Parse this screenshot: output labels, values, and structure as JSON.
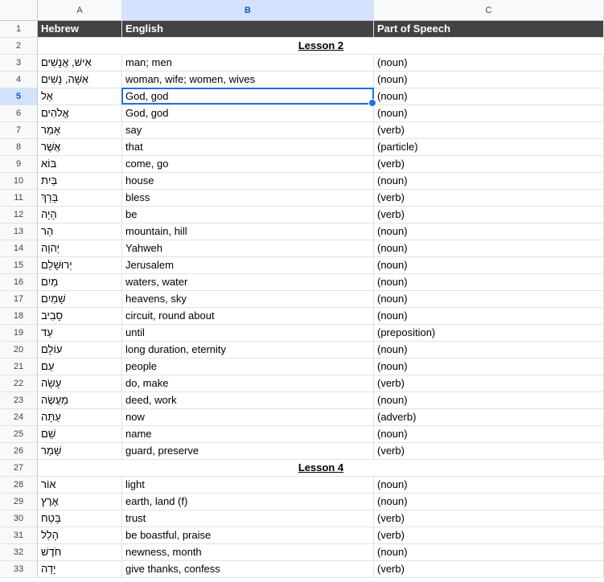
{
  "columns": [
    "A",
    "B",
    "C"
  ],
  "header_row": {
    "num": "1",
    "a": "Hebrew",
    "b": "English",
    "c": "Part of Speech"
  },
  "selected": {
    "row": "5",
    "column": "B"
  },
  "rows": [
    {
      "num": "2",
      "lesson": "Lesson 2"
    },
    {
      "num": "3",
      "a": "אִישׁ, אֲנָשִׁים",
      "b": "man; men",
      "c": "(noun)"
    },
    {
      "num": "4",
      "a": "אִשָּׁה, נָשִׁים",
      "b": "woman, wife; women, wives",
      "c": "(noun)"
    },
    {
      "num": "5",
      "a": "אֵל",
      "b": "God, god",
      "c": "(noun)"
    },
    {
      "num": "6",
      "a": "אֱלֹהִים",
      "b": "God, god",
      "c": "(noun)"
    },
    {
      "num": "7",
      "a": "אָמַר",
      "b": "say",
      "c": "(verb)"
    },
    {
      "num": "8",
      "a": "אֲשֶׁר",
      "b": "that",
      "c": "(particle)"
    },
    {
      "num": "9",
      "a": "בּוֹא",
      "b": "come, go",
      "c": "(verb)"
    },
    {
      "num": "10",
      "a": "בַּיִת",
      "b": "house",
      "c": "(noun)"
    },
    {
      "num": "11",
      "a": "בָּרַךְ",
      "b": "bless",
      "c": "(verb)"
    },
    {
      "num": "12",
      "a": "הָיָה",
      "b": "be",
      "c": "(verb)"
    },
    {
      "num": "13",
      "a": "הַר",
      "b": "mountain, hill",
      "c": "(noun)"
    },
    {
      "num": "14",
      "a": "יְהוָה",
      "b": "Yahweh",
      "c": "(noun)"
    },
    {
      "num": "15",
      "a": "יְרוּשָׁלַם",
      "b": "Jerusalem",
      "c": "(noun)"
    },
    {
      "num": "16",
      "a": "מַיִם",
      "b": "waters, water",
      "c": "(noun)"
    },
    {
      "num": "17",
      "a": "שָׁמַיִם",
      "b": "heavens, sky",
      "c": "(noun)"
    },
    {
      "num": "18",
      "a": "סָבִיב",
      "b": "circuit, round about",
      "c": "(noun)"
    },
    {
      "num": "19",
      "a": "עַד",
      "b": "until",
      "c": "(preposition)"
    },
    {
      "num": "20",
      "a": "עוֹלָם",
      "b": "long duration, eternity",
      "c": "(noun)"
    },
    {
      "num": "21",
      "a": "עַם",
      "b": "people",
      "c": "(noun)"
    },
    {
      "num": "22",
      "a": "עָשָׂה",
      "b": "do, make",
      "c": "(verb)"
    },
    {
      "num": "23",
      "a": "מַעֲשֶׂה",
      "b": "deed, work",
      "c": "(noun)"
    },
    {
      "num": "24",
      "a": "עַתָּה",
      "b": "now",
      "c": "(adverb)"
    },
    {
      "num": "25",
      "a": "שֵׁם",
      "b": "name",
      "c": "(noun)"
    },
    {
      "num": "26",
      "a": "שָׁמַר",
      "b": "guard, preserve",
      "c": "(verb)"
    },
    {
      "num": "27",
      "lesson": "Lesson 4"
    },
    {
      "num": "28",
      "a": "אוֹר",
      "b": "light",
      "c": "(noun)"
    },
    {
      "num": "29",
      "a": "אֶרֶץ",
      "b": "earth, land (f)",
      "c": "(noun)"
    },
    {
      "num": "30",
      "a": "בָּטַח",
      "b": "trust",
      "c": "(verb)"
    },
    {
      "num": "31",
      "a": "הָלַל",
      "b": "be boastful, praise",
      "c": "(verb)"
    },
    {
      "num": "32",
      "a": "חֹדֶשׁ",
      "b": "newness, month",
      "c": "(noun)"
    },
    {
      "num": "33",
      "a": "יָדָה",
      "b": "give thanks, confess",
      "c": "(verb)"
    }
  ]
}
